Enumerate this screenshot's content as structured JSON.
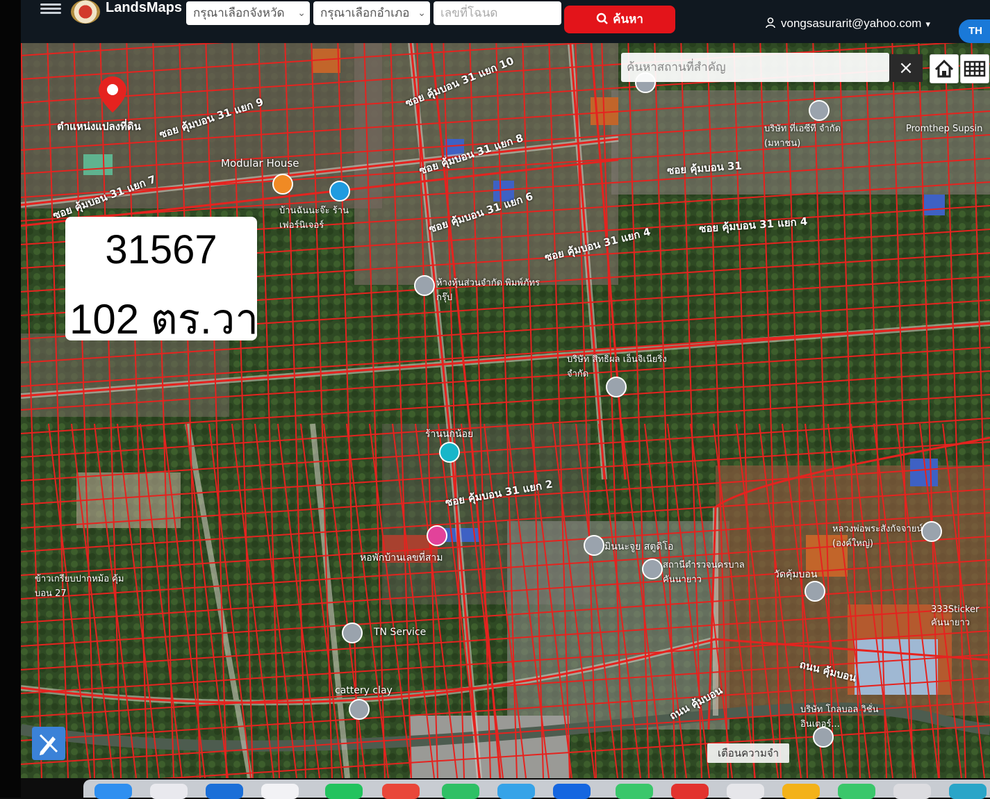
{
  "app": {
    "name": "LandsMaps"
  },
  "topbar": {
    "province_placeholder": "กรุณาเลือกจังหวัด",
    "district_placeholder": "กรุณาเลือกอำเภอ",
    "deed_placeholder": "เลขที่โฉนด",
    "search_label": "ค้นหา",
    "user_email": "vongsasurarit@yahoo.com",
    "language": "TH"
  },
  "map": {
    "place_search_placeholder": "ค้นหาสถานที่สำคัญ",
    "close_symbol": "×",
    "parcel_marker_label": "ตำแหน่งแปลงที่ดิน",
    "road_labels": [
      "ซอย คุ้มบอน 31 แยก 9",
      "ซอย คุ้มบอน 31 แยก 10",
      "ซอย คุ้มบอน 31 แยก 8",
      "ซอย คุ้มบอน 31 แยก 7",
      "ซอย คุ้มบอน 31 แยก 6",
      "ซอย คุ้มบอน 31 แยก 4",
      "ซอย คุ้มบอน 31 แยก 2",
      "ซอย คุ้มบอน 31",
      "ถนน คุ้มบอน"
    ],
    "poi_labels": [
      "Modular House",
      "บ้านฉันนะจ๊ะ ร้านเฟอร์นิเจอร์",
      "ห้างหุ้นส่วนจำกัด พิมพ์ภัทร กรุ๊ป",
      "บริษัท สิทธิผล เอ็นจิเนียริ่ง จำกัด",
      "ร้านนกน้อย",
      "หอพักบ้านเลขที่สาม",
      "มินนะจูย สตูดิโอ",
      "สถานีตำรวจนครบาล คันนายาว",
      "วัดคุ้มบอน",
      "หลวงพ่อพระสังกัจจายน์ (องค์ใหญ่)",
      "333Sticker คันนายาว",
      "ข้าวเกรียบปากหม้อ คุ้มบอน 27",
      "TN Service",
      "cattery clay",
      "บริษัท โกลบอล วิชั่น อินเตอร์...",
      "Promthep Supsin",
      "บริษัท ที่เอซีที จำกัด (มหาชน)"
    ],
    "parcel_card": {
      "parcel_no": "31567",
      "area": "102 ตร.วา"
    },
    "memo_label": "เตือนความจำ"
  },
  "colors": {
    "parcel_line": "#e5231f",
    "search_red": "#e3141a",
    "lang_blue": "#1a79d8",
    "topbar_bg": "#101820"
  },
  "icons": [
    "hamburger-icon",
    "search-icon",
    "user-icon",
    "chevron-down-icon",
    "close-icon",
    "home-icon",
    "grid-icon",
    "location-pin-icon",
    "draw-tool-icon"
  ]
}
